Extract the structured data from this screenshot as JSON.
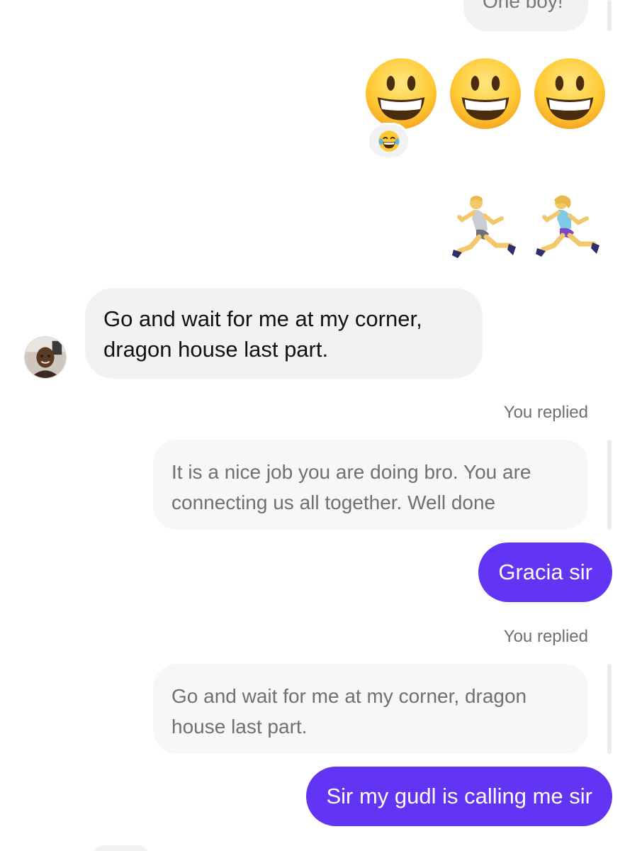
{
  "conversation": {
    "top_bubble_text": "One boy!",
    "emoji_big": [
      "grinning-face",
      "grinning-face",
      "grinning-face"
    ],
    "reaction_emoji": "face-with-tears-of-joy",
    "runner_emojis": [
      "man-running",
      "woman-running"
    ],
    "incoming_message": "Go and wait for me at my corner, dragon house last part.",
    "replies": [
      {
        "label": "You replied",
        "quoted": "It is a nice job you are doing bro. You are connecting us all together. Well done",
        "message": "Gracia sir"
      },
      {
        "label": "You replied",
        "quoted": "Go and wait for me at my corner, dragon house last part.",
        "message": "Sir my gudl is calling me sir"
      }
    ]
  },
  "colors": {
    "outgoing_bubble": "#6234f3",
    "incoming_bubble": "#f2f2f4",
    "quoted_bubble": "#f7f7f8"
  }
}
